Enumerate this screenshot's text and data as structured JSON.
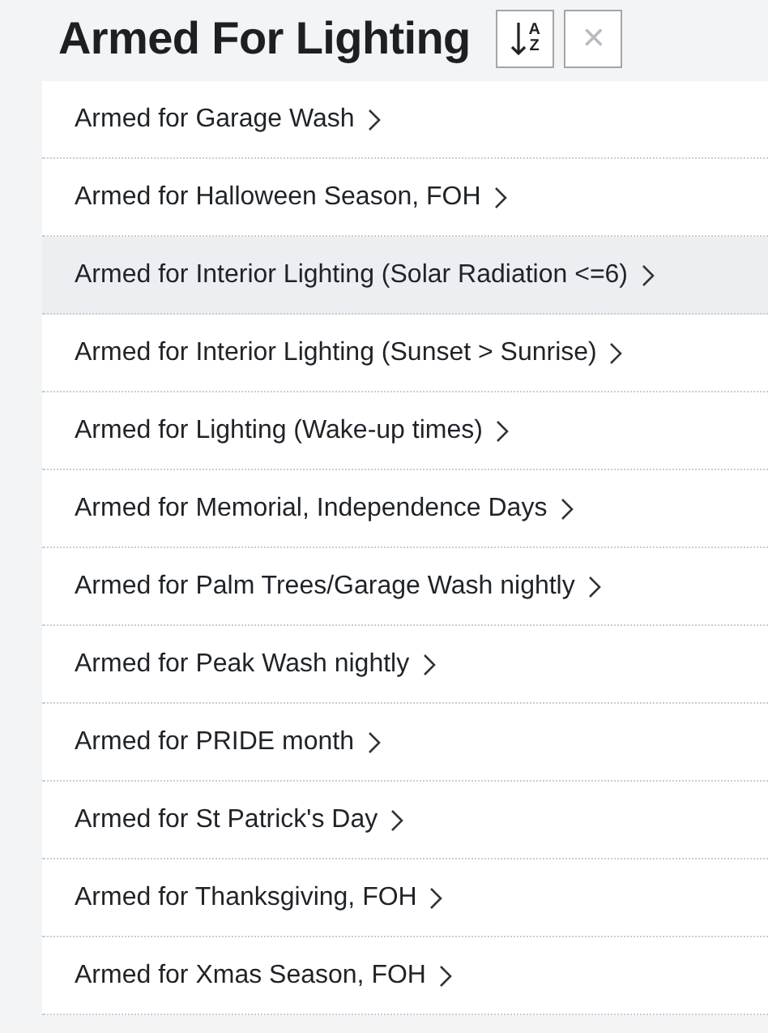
{
  "header": {
    "title": "Armed For Lighting",
    "sort_button": {
      "top": "A",
      "bottom": "Z"
    },
    "close_button": {
      "label": "×",
      "disabled": true
    }
  },
  "items": [
    {
      "label": "Armed for Garage Wash",
      "selected": false
    },
    {
      "label": "Armed for Halloween Season, FOH",
      "selected": false
    },
    {
      "label": "Armed for Interior Lighting (Solar Radiation <=6)",
      "selected": true
    },
    {
      "label": "Armed for Interior Lighting (Sunset > Sunrise)",
      "selected": false
    },
    {
      "label": "Armed for Lighting (Wake-up times)",
      "selected": false
    },
    {
      "label": "Armed for Memorial, Independence Days",
      "selected": false
    },
    {
      "label": "Armed for Palm Trees/Garage Wash nightly",
      "selected": false
    },
    {
      "label": "Armed for Peak Wash nightly",
      "selected": false
    },
    {
      "label": "Armed for PRIDE month",
      "selected": false
    },
    {
      "label": "Armed for St Patrick's Day",
      "selected": false
    },
    {
      "label": "Armed for Thanksgiving, FOH",
      "selected": false
    },
    {
      "label": "Armed for Xmas Season, FOH",
      "selected": false
    }
  ]
}
